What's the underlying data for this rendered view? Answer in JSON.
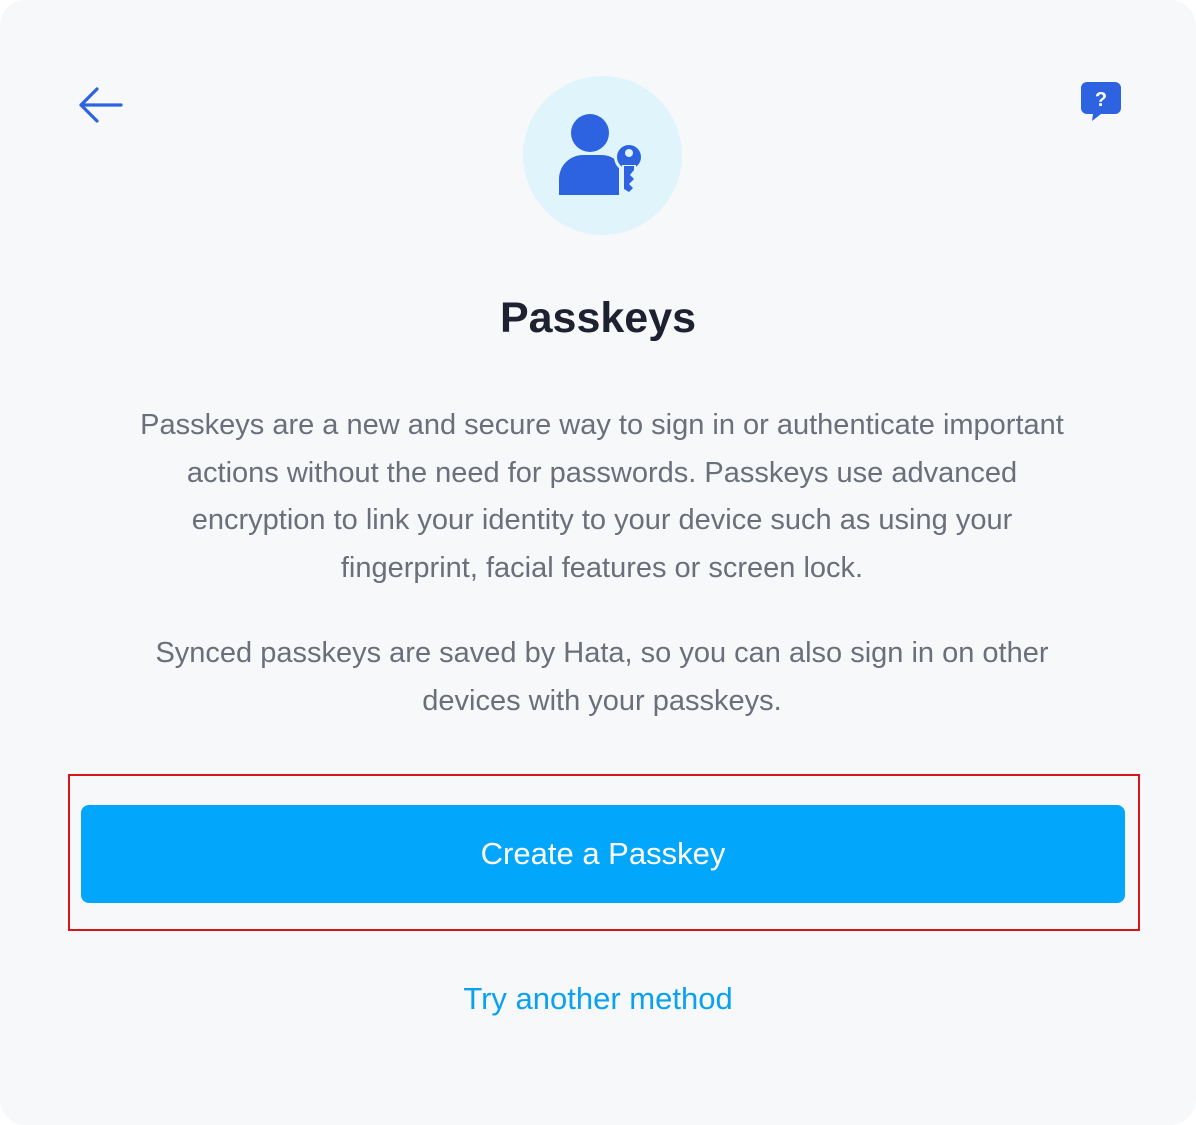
{
  "header": {
    "back_icon": "arrow-left-icon",
    "help_icon": "question-chat-bubble-icon"
  },
  "hero": {
    "icon": "user-key-icon"
  },
  "title": "Passkeys",
  "description": "Passkeys are a new and secure way to sign in or authenticate important\nactions without the need for passwords. Passkeys use advanced\nencryption to link your identity to your device such as using your\nfingerprint, facial features or screen lock.",
  "synced_note": "Synced passkeys are saved by Hata, so you can also sign in on other\ndevices with your passkeys.",
  "actions": {
    "create_label": "Create a Passkey",
    "alternate_label": "Try another method"
  },
  "colors": {
    "accent": "#02a6fb",
    "icon_blue": "#2d63e0",
    "link": "#0aa2f0",
    "highlight": "#d9141b"
  }
}
